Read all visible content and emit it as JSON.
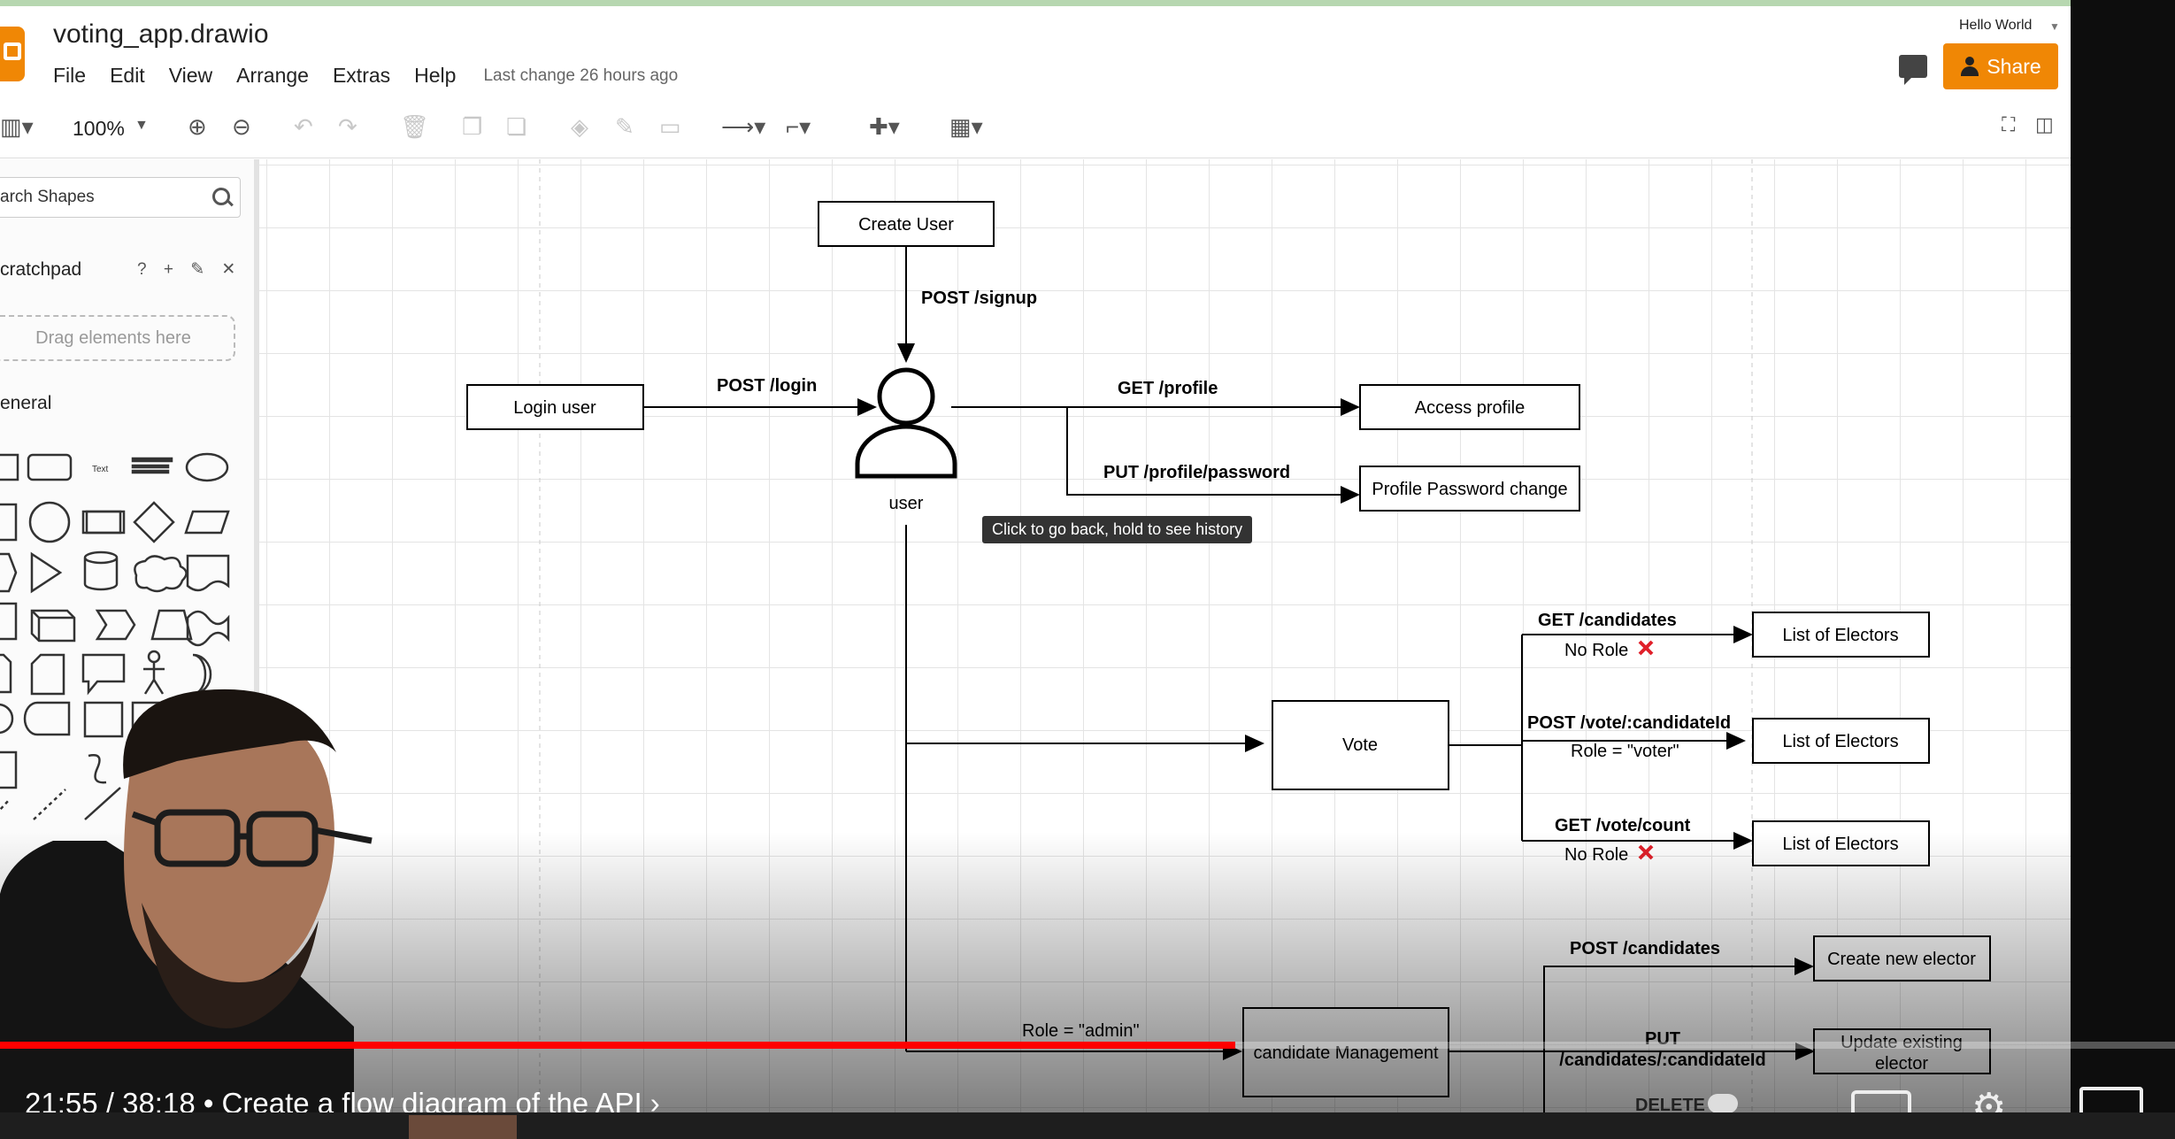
{
  "app": {
    "file_title": "voting_app.drawio",
    "menu": [
      "File",
      "Edit",
      "View",
      "Arrange",
      "Extras",
      "Help"
    ],
    "last_change": "Last change 26 hours ago",
    "user_name": "Hello World",
    "share_label": "Share"
  },
  "toolbar": {
    "zoom": "100%"
  },
  "sidebar": {
    "search_placeholder": "arch Shapes",
    "scratchpad_label": "cratchpad",
    "scratchpad_tools": "? + ✎ ✕",
    "drag_hint": "Drag elements here",
    "general_label": "eneral"
  },
  "diagram": {
    "nodes": {
      "create_user": "Create User",
      "login_user": "Login user",
      "user": "user",
      "access_profile": "Access profile",
      "password_change": "Profile Password change",
      "vote": "Vote",
      "list1": "List of Electors",
      "list2": "List of Electors",
      "list3": "List of Electors",
      "candidate_mgmt": "candidate Management",
      "create_elector": "Create new elector",
      "update_elector_1": "Update existing",
      "update_elector_2": "elector"
    },
    "edges": {
      "signup": "POST /signup",
      "login": "POST /login",
      "profile": "GET  /profile",
      "password": "PUT  /profile/password",
      "candidates": "GET  /candidates",
      "no_role_1": "No Role",
      "vote_post": "POST  /vote/:candidateId",
      "role_voter": "Role = \"voter\"",
      "vote_count": "GET  /vote/count",
      "no_role_2": "No Role",
      "role_admin": "Role = \"admin\"",
      "post_candidates": "POST  /candidates",
      "put_1": "PUT",
      "put_2": "/candidates/:candidateId",
      "delete": "DELETE"
    },
    "tooltip": "Click to go back, hold to see history"
  },
  "video": {
    "timecode": "21:55 / 38:18  •  Create a flow diagram of the API  ›",
    "progress_fraction": 0.568
  },
  "colors": {
    "accent": "#f08705",
    "progress": "#ff0000",
    "cross": "#e0202a"
  }
}
